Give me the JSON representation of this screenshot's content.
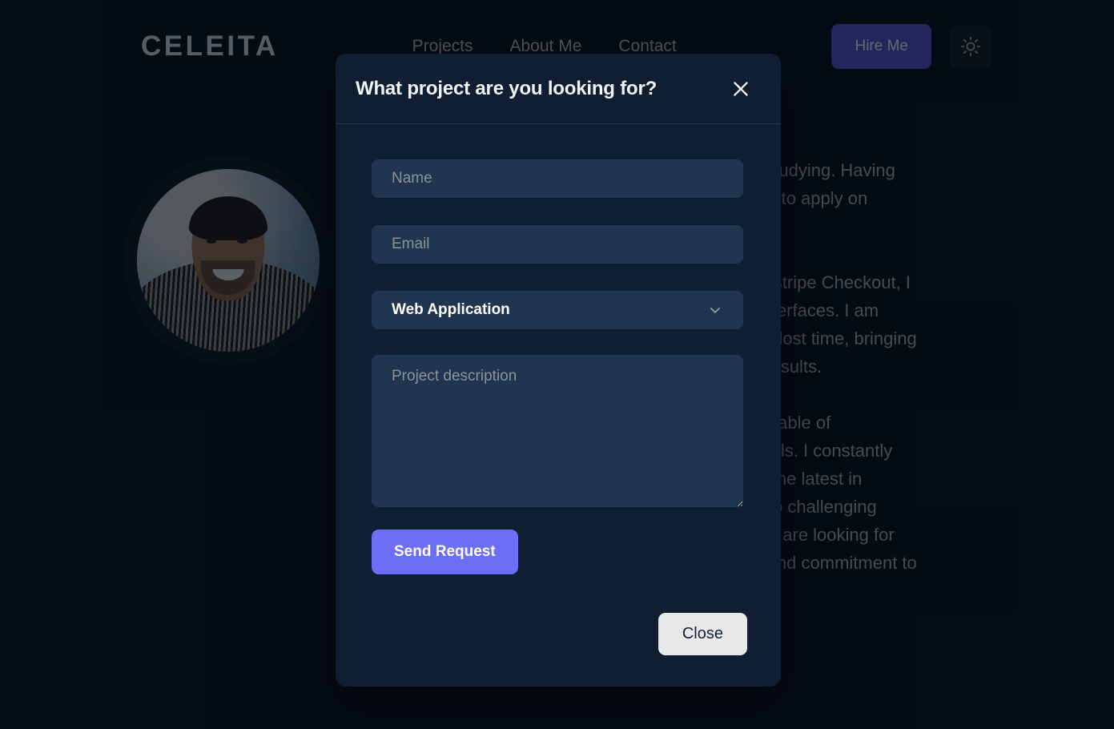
{
  "navbar": {
    "logo": "CELEITA",
    "links": [
      {
        "label": "Projects"
      },
      {
        "label": "About Me"
      },
      {
        "label": "Contact"
      }
    ],
    "hire_label": "Hire Me",
    "theme_icon": "sun-icon",
    "accent_color": "#5b56d6"
  },
  "hero": {
    "avatar_alt": "profile-photo",
    "bio_paragraphs": [
      "I am a developer with experience and currently studying. Having worked direct with META, I have solid knowledge to apply on project.",
      "Working with React, Next.js, Node, Python, and Stripe Checkout, I specialize in building fast and responsive user interfaces. I am highly motivated and committed to making up for lost time, bringing a level of responsibility and maturity that drives results.",
      "I consider myself a detail-oriented developer, capable of collaborating within a team to achieve project goals. I constantly seek to improve my skills to stay up to date with the latest in software development. I am eager to contribute to challenging projects and learn from experienced peers. If you are looking for someone with solid fundamentals, strong drive, and commitment to excellence, I would love to connect."
    ]
  },
  "modal": {
    "title": "What project are you looking for?",
    "close_icon": "close-icon",
    "fields": {
      "name_placeholder": "Name",
      "name_value": "",
      "email_placeholder": "Email",
      "email_value": "",
      "project_type_selected": "Web Application",
      "project_type_options": [
        "Web Application"
      ],
      "chevron_icon": "chevron-down-icon",
      "description_placeholder": "Project description",
      "description_value": ""
    },
    "send_label": "Send Request",
    "close_label": "Close",
    "send_color": "#6c6ef5"
  }
}
